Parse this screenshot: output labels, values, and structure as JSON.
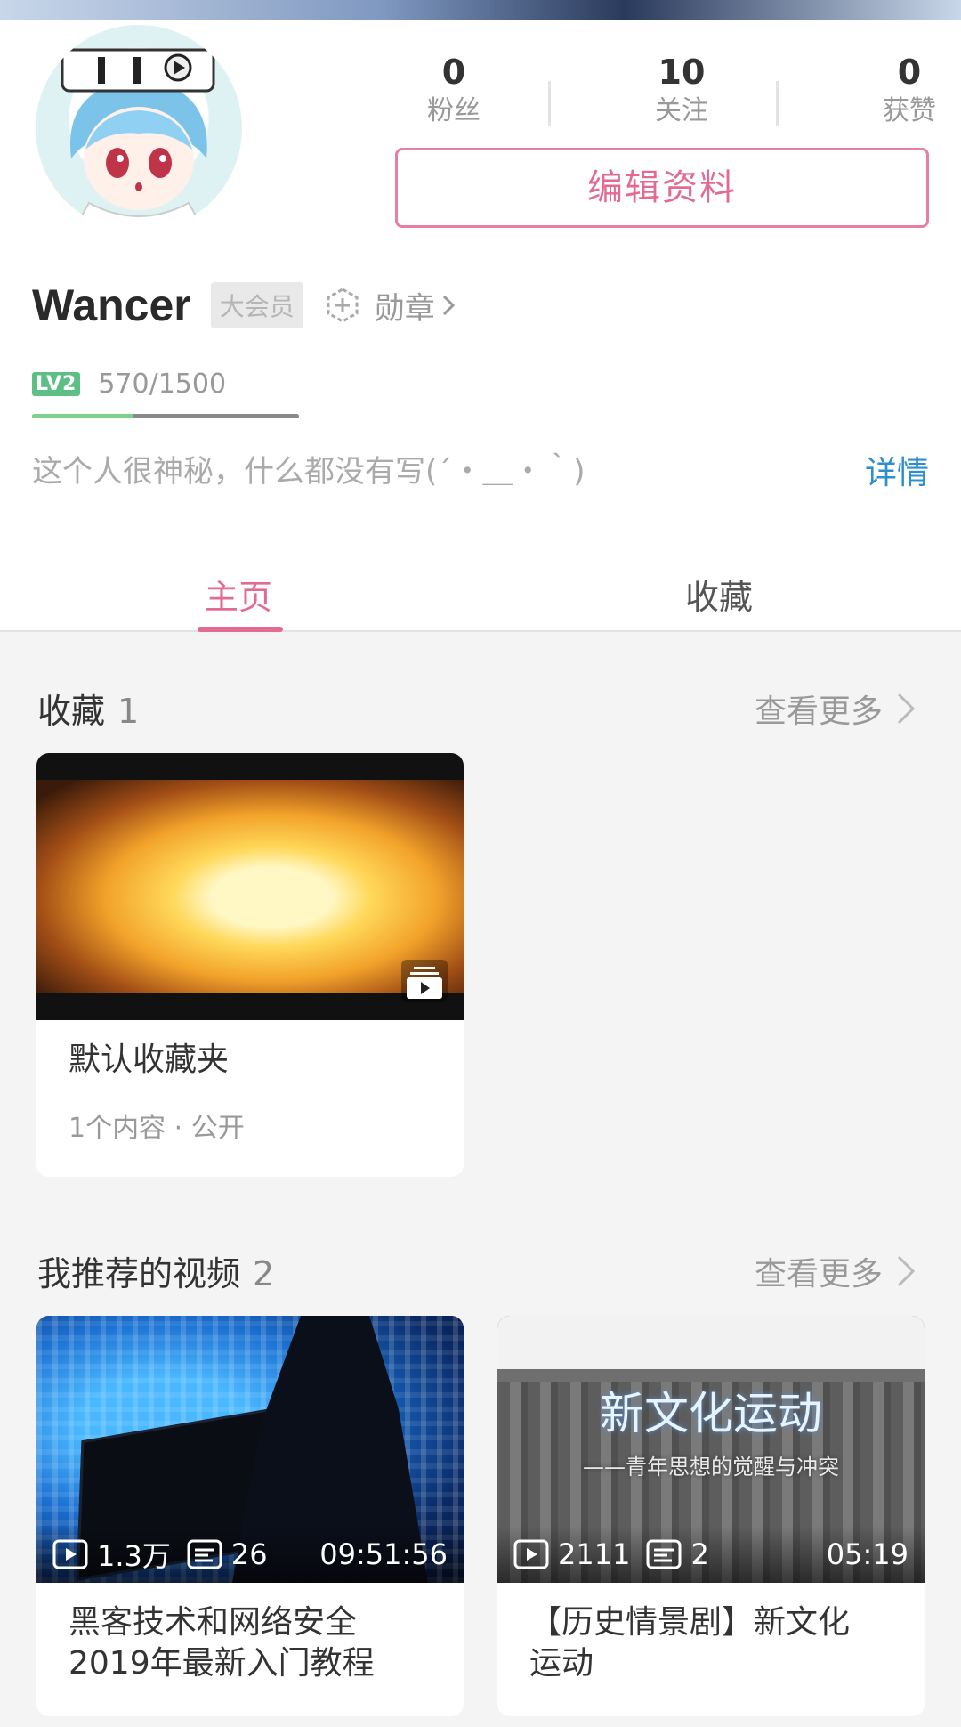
{
  "profile": {
    "username": "Wancer",
    "vip_label": "大会员",
    "medal_label": "勋章",
    "level_label": "LV2",
    "exp_text": "570/1500",
    "exp_progress": 0.38,
    "signature": "这个人很神秘，什么都没有写(´・＿・｀)",
    "detail_label": "详情",
    "edit_button": "编辑资料"
  },
  "stats": [
    {
      "value": "0",
      "label": "粉丝"
    },
    {
      "value": "10",
      "label": "关注"
    },
    {
      "value": "0",
      "label": "获赞"
    }
  ],
  "tabs": [
    {
      "label": "主页",
      "active": true
    },
    {
      "label": "收藏",
      "active": false
    }
  ],
  "favorites_section": {
    "title": "收藏",
    "count": "1",
    "more_label": "查看更多",
    "folder": {
      "title": "默认收藏夹",
      "subtitle": "1个内容 · 公开"
    }
  },
  "recommended_section": {
    "title": "我推荐的视频",
    "count": "2",
    "more_label": "查看更多",
    "videos": [
      {
        "views": "1.3万",
        "danmaku": "26",
        "duration": "09:51:56",
        "title": "黑客技术和网络安全2019年最新入门教程"
      },
      {
        "views": "2111",
        "danmaku": "2",
        "duration": "05:19",
        "title": "【历史情景剧】新文化运动",
        "thumb_title": "新文化运动",
        "thumb_subtitle": "——青年思想的觉醒与冲突"
      }
    ]
  },
  "colors": {
    "accent": "#e26a93",
    "link": "#2d8fd0",
    "level": "#5dbf84"
  }
}
